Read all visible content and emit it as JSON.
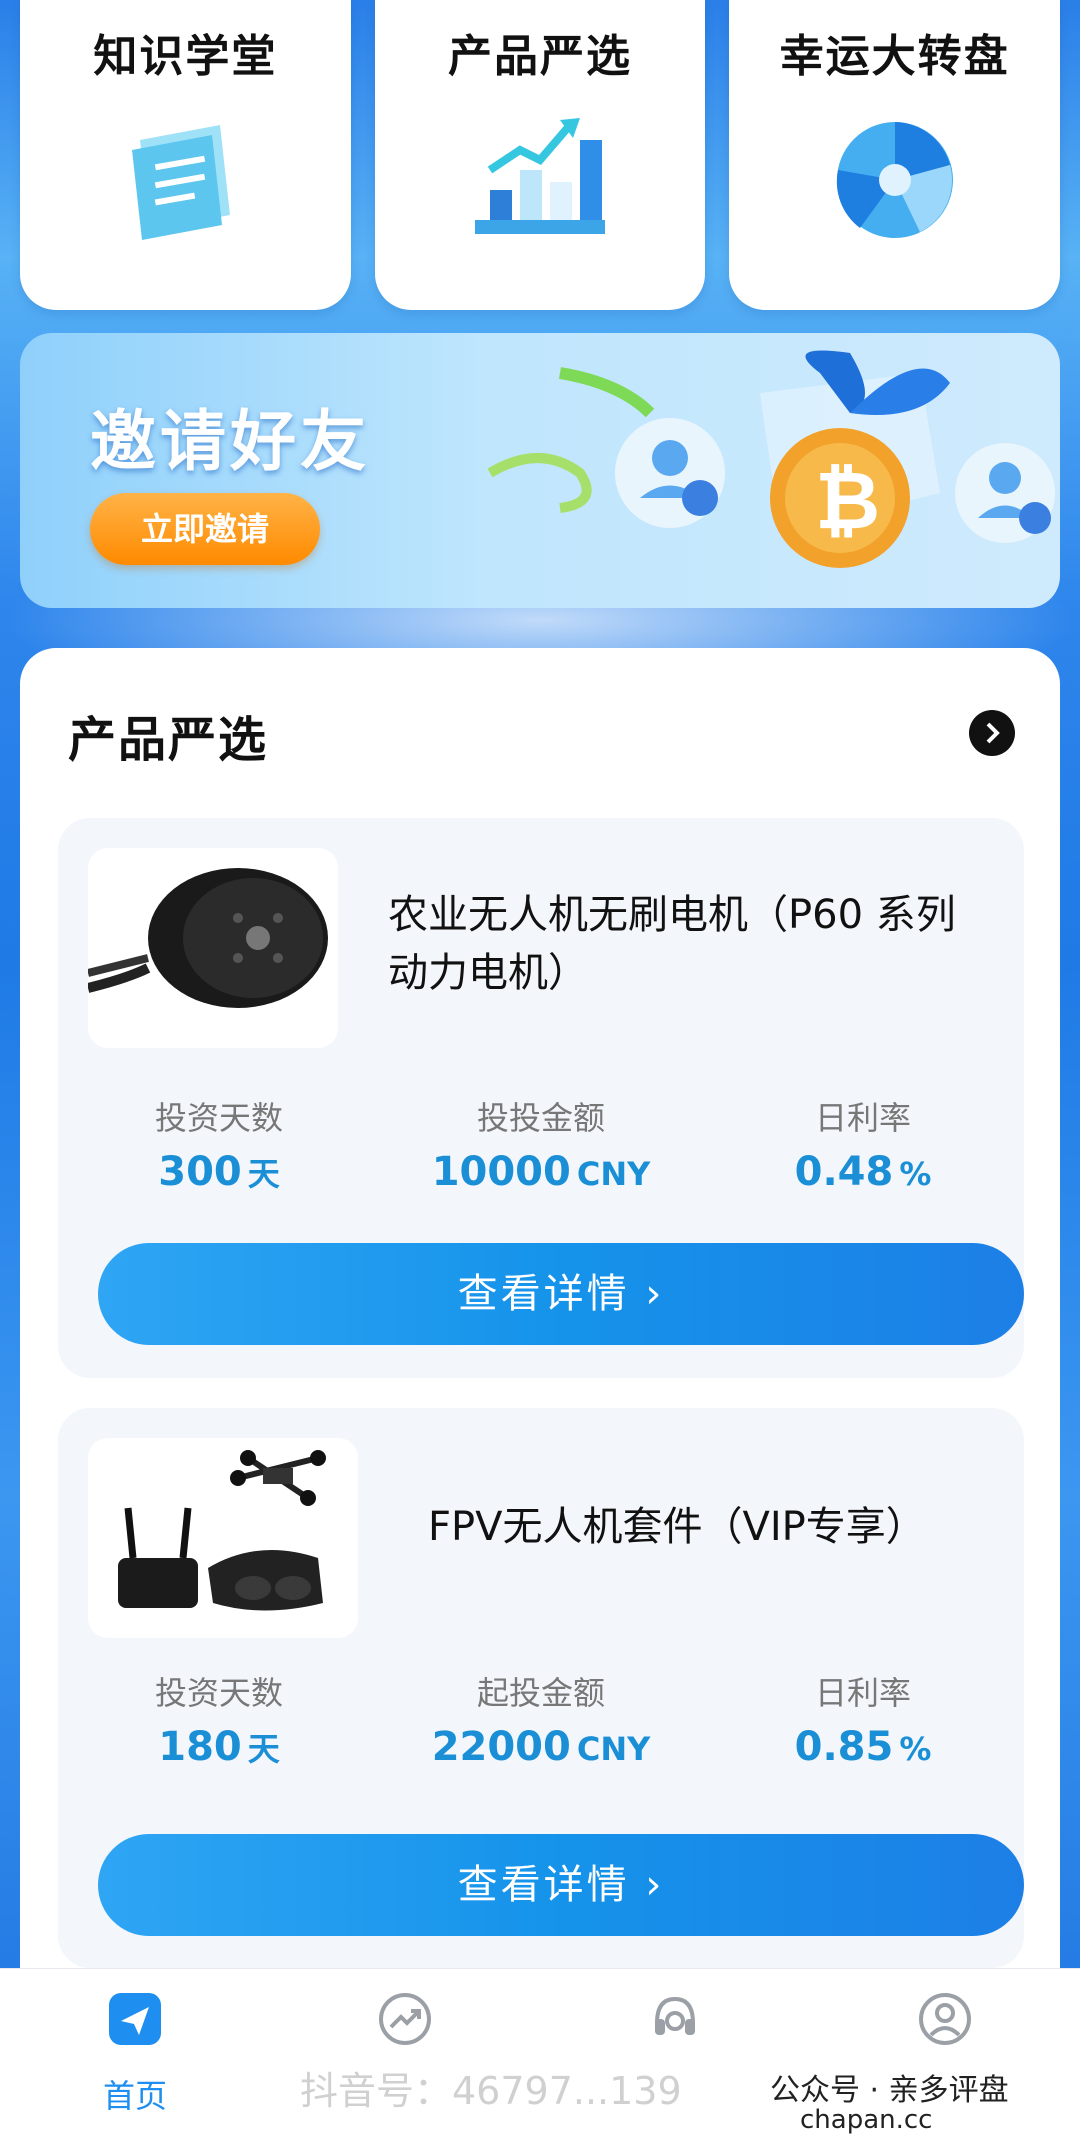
{
  "top_cards": [
    {
      "label": "知识学堂",
      "icon": "document-icon"
    },
    {
      "label": "产品严选",
      "icon": "growth-chart-icon"
    },
    {
      "label": "幸运大转盘",
      "icon": "wheel-icon"
    }
  ],
  "invite": {
    "title": "邀请好友",
    "button": "立即邀请"
  },
  "section": {
    "title": "产品严选"
  },
  "products": [
    {
      "name": "农业无人机无刷电机（P60 系列动力电机）",
      "image": "brushless-motor-image",
      "stats": [
        {
          "label": "投资天数",
          "value": "300",
          "unit": "天"
        },
        {
          "label": "投投金额",
          "value": "10000",
          "unit": "CNY"
        },
        {
          "label": "日利率",
          "value": "0.48",
          "unit": "%"
        }
      ],
      "button": "查看详情 ›"
    },
    {
      "name": "FPV无人机套件（VIP专享）",
      "image": "fpv-drone-kit-image",
      "stats": [
        {
          "label": "投资天数",
          "value": "180",
          "unit": "天"
        },
        {
          "label": "起投金额",
          "value": "22000",
          "unit": "CNY"
        },
        {
          "label": "日利率",
          "value": "0.85",
          "unit": "%"
        }
      ],
      "button": "查看详情 ›"
    }
  ],
  "tabbar": [
    {
      "label": "首页",
      "icon": "send-icon",
      "active": true
    },
    {
      "label": "",
      "icon": "trend-icon",
      "active": false
    },
    {
      "label": "",
      "icon": "headset-icon",
      "active": false
    },
    {
      "label": "",
      "icon": "user-icon",
      "active": false
    }
  ],
  "watermarks": {
    "douyin": "抖音号：46797...139",
    "wechat": "公众号 · 亲多评盘",
    "site": "chapan.cc"
  },
  "colors": {
    "accent": "#1e8ff0",
    "stat_value": "#1b8fd6",
    "invite_button": "#ff8a00"
  }
}
